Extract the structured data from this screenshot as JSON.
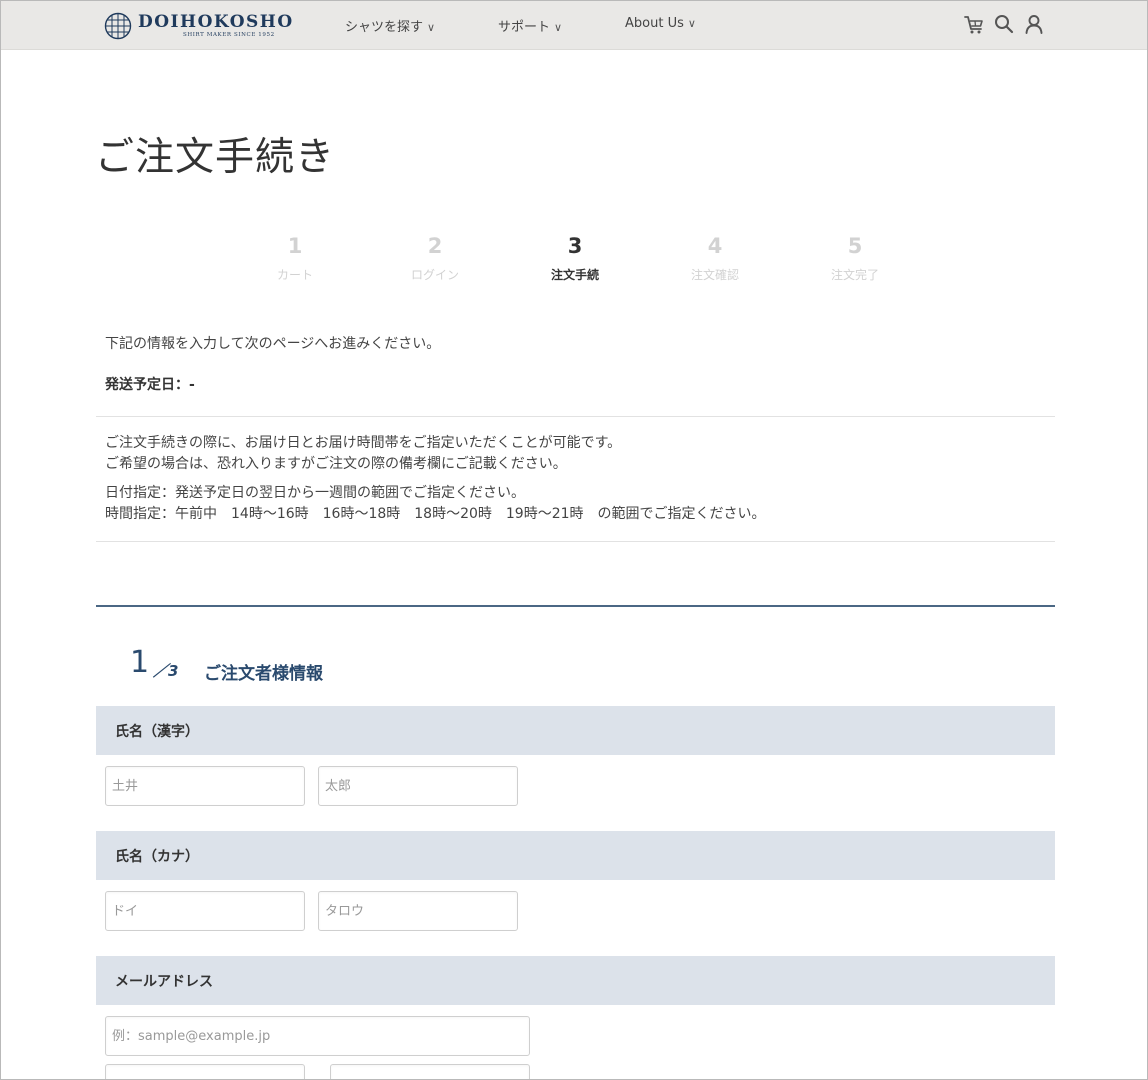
{
  "header": {
    "brand": "DOIHOKOSHO",
    "tagline": "SHIRT MAKER SINCE 1952",
    "nav": [
      {
        "label": "シャツを探す"
      },
      {
        "label": "サポート"
      },
      {
        "label": "About Us"
      }
    ],
    "chevron": "∨",
    "icons": [
      "cart-icon",
      "search-icon",
      "user-icon"
    ]
  },
  "page_title": "ご注文手続き",
  "steps": [
    {
      "num": "1",
      "label": "カート",
      "active": false
    },
    {
      "num": "2",
      "label": "ログイン",
      "active": false
    },
    {
      "num": "3",
      "label": "注文手続",
      "active": true
    },
    {
      "num": "4",
      "label": "注文確認",
      "active": false
    },
    {
      "num": "5",
      "label": "注文完了",
      "active": false
    }
  ],
  "intro": "下記の情報を入力して次のページへお進みください。",
  "ship_date": "発送予定日：-",
  "notice": {
    "line1": "ご注文手続きの際に、お届け日とお届け時間帯をご指定いただくことが可能です。",
    "line2": "ご希望の場合は、恐れ入りますがご注文の際の備考欄にご記載ください。",
    "line3": "日付指定：発送予定日の翌日から一週間の範囲でご指定ください。",
    "line4": "時間指定：午前中　14時〜16時　16時〜18時　18時〜20時　19時〜21時　の範囲でご指定ください。"
  },
  "section": {
    "num": "1",
    "den": "／3",
    "title": "ご注文者様情報"
  },
  "fields": {
    "name_kanji": {
      "label": "氏名（漢字）",
      "last_placeholder": "土井",
      "first_placeholder": "太郎"
    },
    "name_kana": {
      "label": "氏名（カナ）",
      "last_placeholder": "ドイ",
      "first_placeholder": "タロウ"
    },
    "email": {
      "label": "メールアドレス",
      "placeholder": "例：sample@example.jp"
    }
  },
  "colors": {
    "header_bg": "#e9e8e6",
    "brand": "#1f3a5c",
    "band_bg": "#dce2ea",
    "section_accent": "#2a4a6e"
  }
}
